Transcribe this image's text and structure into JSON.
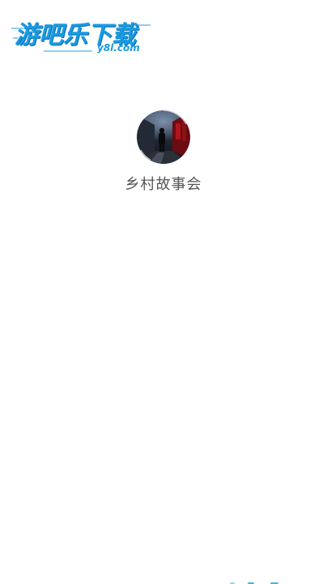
{
  "watermark": {
    "brand_cn": "游吧乐下载",
    "brand_domain": "y8l.com"
  },
  "profile": {
    "app_name": "乡村故事会"
  },
  "colors": {
    "background": "#ffffff",
    "watermark_blue": "#1a9be0",
    "name_text": "#555555"
  }
}
